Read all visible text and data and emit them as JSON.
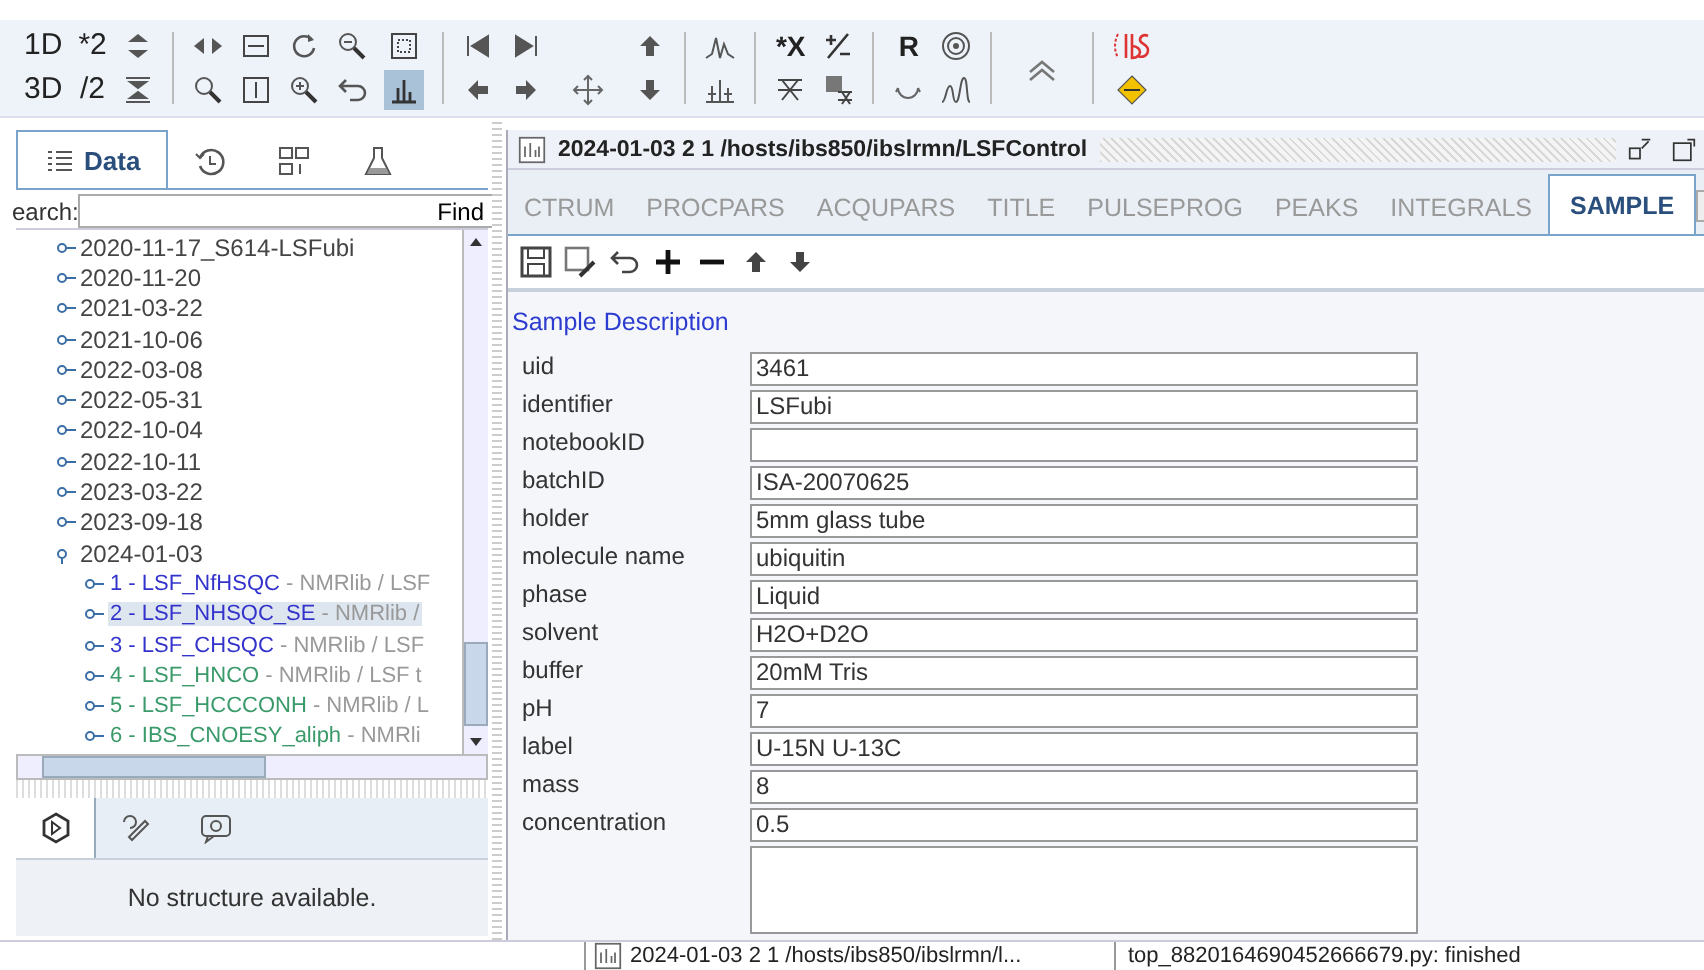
{
  "toolbar": {
    "text_buttons": [
      {
        "label": "1D"
      },
      {
        "label": "3D"
      },
      {
        "label": "*2"
      },
      {
        "label": "/2"
      }
    ],
    "mid_text_buttons": [
      {
        "label": "*X"
      },
      {
        "label": "R"
      }
    ],
    "icons_selected": [
      {
        "selected": true
      }
    ]
  },
  "left_panel": {
    "tabs": [
      {
        "label": "Data",
        "selected": true
      },
      {
        "selected": false
      },
      {
        "selected": false
      },
      {
        "selected": false
      }
    ],
    "search": {
      "label": "earch:",
      "button": "Find"
    },
    "tree": [
      {
        "label": "2020-11-17_S614-LSFubi",
        "expanded": false
      },
      {
        "label": "2020-11-20",
        "expanded": false
      },
      {
        "label": "2021-03-22",
        "expanded": false
      },
      {
        "label": "2021-10-06",
        "expanded": false
      },
      {
        "label": "2022-03-08",
        "expanded": false
      },
      {
        "label": "2022-05-31",
        "expanded": false
      },
      {
        "label": "2022-10-04",
        "expanded": false
      },
      {
        "label": "2022-10-11",
        "expanded": false
      },
      {
        "label": "2023-03-22",
        "expanded": false
      },
      {
        "label": "2023-09-18",
        "expanded": false
      },
      {
        "label": "2024-01-03",
        "expanded": true,
        "children": [
          {
            "label": "1 - LSF_NfHSQC",
            "note": " - NMRlib / LSF",
            "color": "#3333cc",
            "selected": false
          },
          {
            "label": "2 - LSF_NHSQC_SE",
            "note": " - NMRlib /",
            "color": "#3333cc",
            "selected": true
          },
          {
            "label": "3 - LSF_CHSQC",
            "note": " - NMRlib / LSF",
            "color": "#3333cc",
            "selected": false
          },
          {
            "label": "4 - LSF_HNCO",
            "note": " - NMRlib / LSF t",
            "color": "#3a9a6a",
            "selected": false
          },
          {
            "label": "5 - LSF_HCCCONH",
            "note": " - NMRlib / L",
            "color": "#3a9a6a",
            "selected": false
          },
          {
            "label": "6 - IBS_CNOESY_aliph",
            "note": " - NMRli",
            "color": "#3a9a6a",
            "selected": false
          }
        ]
      }
    ],
    "lower_tabs": [
      {
        "selected": true
      },
      {
        "selected": false
      },
      {
        "selected": false
      }
    ],
    "lower_message": "No structure available."
  },
  "dataset_window": {
    "title": "2024-01-03  2  1  /hosts/ibs850/ibslrmn/LSFControl",
    "tabs": [
      {
        "label": "CTRUM",
        "selected": false
      },
      {
        "label": "PROCPARS",
        "selected": false
      },
      {
        "label": "ACQUPARS",
        "selected": false
      },
      {
        "label": "TITLE",
        "selected": false
      },
      {
        "label": "PULSEPROG",
        "selected": false
      },
      {
        "label": "PEAKS",
        "selected": false
      },
      {
        "label": "INTEGRALS",
        "selected": false
      },
      {
        "label": "SAMPLE",
        "selected": true
      }
    ],
    "section_title": "Sample Description",
    "fields": [
      {
        "label": "uid",
        "value": "3461"
      },
      {
        "label": "identifier",
        "value": "LSFubi"
      },
      {
        "label": "notebookID"
      },
      {
        "label": "batchID",
        "value": "ISA-20070625"
      },
      {
        "label": "holder",
        "value": "5mm glass tube"
      },
      {
        "label": "molecule name",
        "value": "ubiquitin"
      },
      {
        "label": "phase",
        "value": "Liquid"
      },
      {
        "label": "solvent",
        "value": "H2O+D2O"
      },
      {
        "label": "buffer",
        "value": "20mM Tris"
      },
      {
        "label": "pH",
        "value": "7"
      },
      {
        "label": "label",
        "value": "U-15N U-13C"
      },
      {
        "label": "mass",
        "value": "8"
      },
      {
        "label": "concentration",
        "value": "0.5"
      }
    ]
  },
  "status_bar": {
    "dataset": "2024-01-03  2  1  /hosts/ibs850/ibslrmn/l...",
    "message": "top_8820164690452666679.py: finished"
  }
}
